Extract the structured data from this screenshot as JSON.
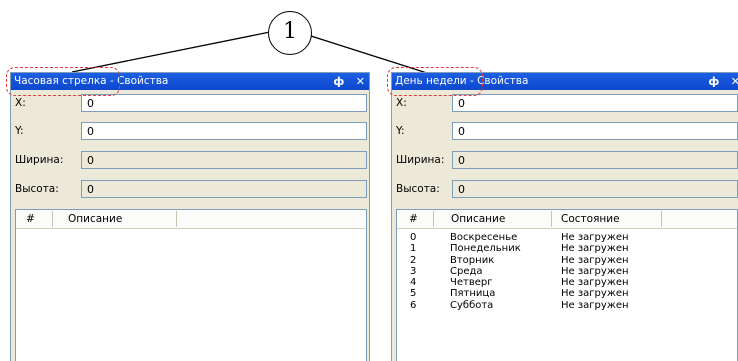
{
  "callout": {
    "number": "1"
  },
  "left_panel": {
    "title_part1": "Часовая стрелка",
    "title_part2": " - Свойства",
    "pin_glyph": "ф",
    "close_glyph": "✕",
    "fields": {
      "x": {
        "label": "X:",
        "value": "0"
      },
      "y": {
        "label": "Y:",
        "value": "0"
      },
      "width": {
        "label": "Ширина:",
        "value": "0"
      },
      "height": {
        "label": "Высота:",
        "value": "0"
      }
    },
    "list": {
      "col_num": "#",
      "col_desc": "Описание",
      "rows": []
    }
  },
  "right_panel": {
    "title_part1": "День недели",
    "title_part2": " - Свойства",
    "pin_glyph": "ф",
    "close_glyph": "✕",
    "fields": {
      "x": {
        "label": "X:",
        "value": "0"
      },
      "y": {
        "label": "Y:",
        "value": "0"
      },
      "width": {
        "label": "Ширина:",
        "value": "0"
      },
      "height": {
        "label": "Высота:",
        "value": "0"
      }
    },
    "list": {
      "col_num": "#",
      "col_desc": "Описание",
      "col_state": "Состояние",
      "rows": [
        {
          "num": "0",
          "desc": "Воскресенье",
          "state": "Не загружен"
        },
        {
          "num": "1",
          "desc": "Понедельник",
          "state": "Не загружен"
        },
        {
          "num": "2",
          "desc": "Вторник",
          "state": "Не загружен"
        },
        {
          "num": "3",
          "desc": "Среда",
          "state": "Не загружен"
        },
        {
          "num": "4",
          "desc": "Четверг",
          "state": "Не загружен"
        },
        {
          "num": "5",
          "desc": "Пятница",
          "state": "Не загружен"
        },
        {
          "num": "6",
          "desc": "Суббота",
          "state": "Не загружен"
        }
      ]
    }
  }
}
